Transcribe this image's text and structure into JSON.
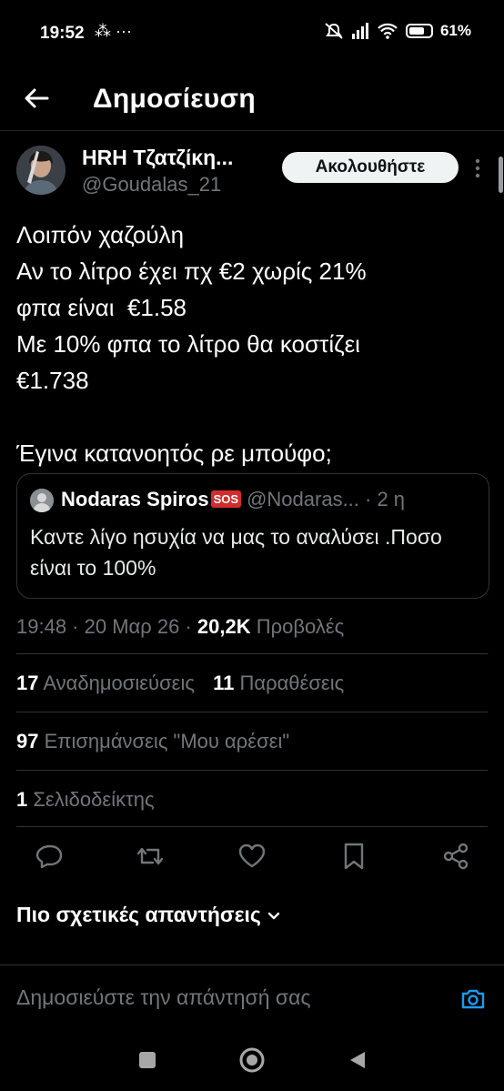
{
  "status_bar": {
    "time": "19:52",
    "left_icons": "⁂ ···",
    "battery": "61%"
  },
  "header": {
    "title": "Δημοσίευση"
  },
  "tweet": {
    "author_name": "HRH Τζατζίκη...",
    "author_handle": "@Goudalas_21",
    "follow_label": "Ακολουθήστε",
    "text_lines": [
      "Λοιπόν χαζούλη",
      "Αν το λίτρο έχει πχ €2 χωρίς 21%",
      "φπα είναι  €1.58",
      "Με 10% φπα το λίτρο θα κοστίζει",
      "€1.738",
      "",
      "Έγινα κατανοητός ρε μπούφο;"
    ],
    "quote": {
      "name": "Nodaras Spiros",
      "badge": "SOS",
      "handle": "@Nodaras... · 2 η",
      "text": "Καντε λίγο ησυχία να μας το αναλύσει .Ποσο είναι το 100%"
    },
    "meta": {
      "time_date": "19:48 · 20 Μαρ 26 · ",
      "views_count": "20,2K",
      "views_label": " Προβολές"
    },
    "stats": {
      "reposts_count": "17",
      "reposts_label": " Αναδημοσιεύσεις",
      "quotes_count": "11",
      "quotes_label": " Παραθέσεις",
      "likes_count": "97",
      "likes_label": " Επισημάνσεις \"Μου αρέσει\"",
      "bookmarks_count": "1",
      "bookmarks_label": " Σελιδοδείκτης"
    }
  },
  "replies_filter": {
    "label": "Πιο σχετικές απαντήσεις"
  },
  "reply_bar": {
    "placeholder": "Δημοσιεύστε την απάντησή σας"
  },
  "colors": {
    "accent": "#1d9bf0",
    "muted": "#71767b",
    "background": "#000000"
  }
}
